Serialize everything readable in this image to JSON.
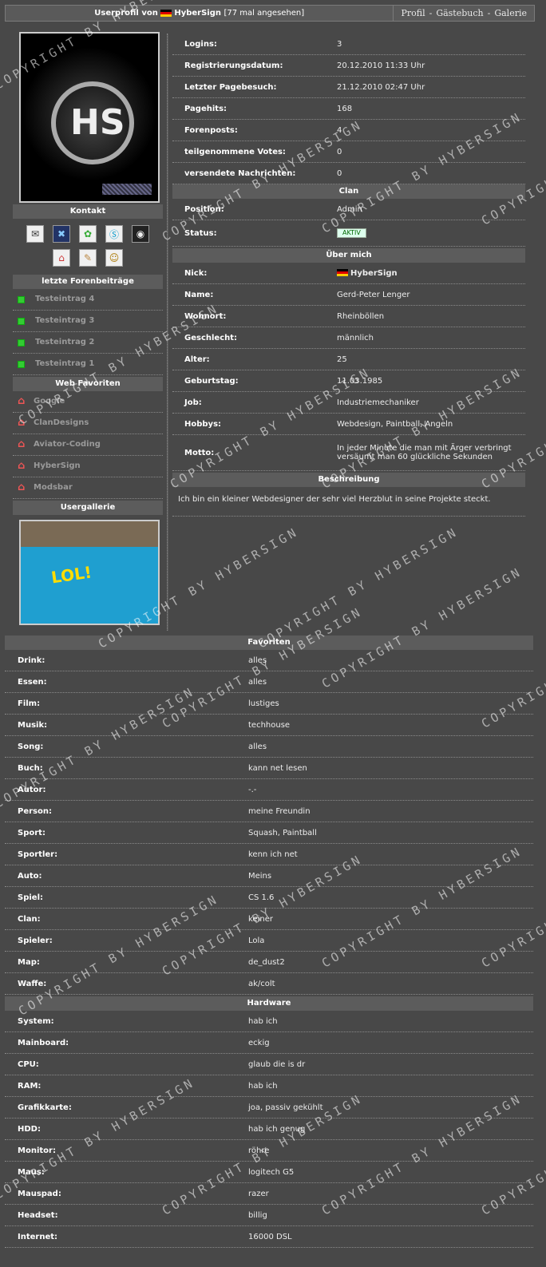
{
  "topbar": {
    "title_prefix": "Userprofil von",
    "username": "HyberSign",
    "views": "[77 mal angesehen]",
    "nav": [
      "Profil",
      "-",
      "Gästebuch",
      "-",
      "Galerie"
    ]
  },
  "sidebar": {
    "contact_header": "Kontakt",
    "forum_header": "letzte Forenbeiträge",
    "forum_posts": [
      "Testeintrag 4",
      "Testeintrag 3",
      "Testeintrag 2",
      "Testeintrag 1"
    ],
    "favorites_header": "Web Favoriten",
    "web_favorites": [
      "Google",
      "ClanDesigns",
      "Aviator-Coding",
      "HyberSign",
      "Modsbar"
    ],
    "gallery_header": "Usergallerie",
    "gallery_caption": "LOL!"
  },
  "stats": [
    {
      "label": "Logins:",
      "value": "3"
    },
    {
      "label": "Registrierungsdatum:",
      "value": "20.12.2010 11:33 Uhr"
    },
    {
      "label": "Letzter Pagebesuch:",
      "value": "21.12.2010 02:47 Uhr"
    },
    {
      "label": "Pagehits:",
      "value": "168"
    },
    {
      "label": "Forenposts:",
      "value": "4"
    },
    {
      "label": "teilgenommene Votes:",
      "value": "0"
    },
    {
      "label": "versendete Nachrichten:",
      "value": "0"
    }
  ],
  "clan": {
    "header": "Clan",
    "position_label": "Position:",
    "position_value": "Admin",
    "status_label": "Status:",
    "status_badge": "AKTIV"
  },
  "about": {
    "header": "Über mich",
    "rows": [
      {
        "label": "Nick:",
        "value": "HyberSign"
      },
      {
        "label": "Name:",
        "value": "Gerd-Peter Lenger"
      },
      {
        "label": "Wohnort:",
        "value": "Rheinböllen"
      },
      {
        "label": "Geschlecht:",
        "value": "männlich"
      },
      {
        "label": "Alter:",
        "value": "25"
      },
      {
        "label": "Geburtstag:",
        "value": "11.03.1985"
      },
      {
        "label": "Job:",
        "value": "Industriemechaniker"
      },
      {
        "label": "Hobbys:",
        "value": "Webdesign, Paintball, Angeln"
      },
      {
        "label": "Motto:",
        "value": "In jeder Minute die man mit Ärger verbringt versäumt man 60 glückliche Sekunden"
      }
    ]
  },
  "description": {
    "header": "Beschreibung",
    "text": "Ich bin ein kleiner Webdesigner der sehr viel Herzblut in seine Projekte steckt."
  },
  "favorites": {
    "header": "Favoriten",
    "rows": [
      {
        "label": "Drink:",
        "value": "alles"
      },
      {
        "label": "Essen:",
        "value": "alles"
      },
      {
        "label": "Film:",
        "value": "lustiges"
      },
      {
        "label": "Musik:",
        "value": "techhouse"
      },
      {
        "label": "Song:",
        "value": "alles"
      },
      {
        "label": "Buch:",
        "value": "kann net lesen"
      },
      {
        "label": "Autor:",
        "value": "-.-"
      },
      {
        "label": "Person:",
        "value": "meine Freundin"
      },
      {
        "label": "Sport:",
        "value": "Squash, Paintball"
      },
      {
        "label": "Sportler:",
        "value": "kenn ich net"
      },
      {
        "label": "Auto:",
        "value": "Meins"
      },
      {
        "label": "Spiel:",
        "value": "CS 1.6"
      },
      {
        "label": "Clan:",
        "value": "keiner"
      },
      {
        "label": "Spieler:",
        "value": "Lola"
      },
      {
        "label": "Map:",
        "value": "de_dust2"
      },
      {
        "label": "Waffe:",
        "value": "ak/colt"
      }
    ]
  },
  "hardware": {
    "header": "Hardware",
    "rows": [
      {
        "label": "System:",
        "value": "hab ich"
      },
      {
        "label": "Mainboard:",
        "value": "eckig"
      },
      {
        "label": "CPU:",
        "value": "glaub die is dr"
      },
      {
        "label": "RAM:",
        "value": "hab ich"
      },
      {
        "label": "Grafikkarte:",
        "value": "joa, passiv gekühlt"
      },
      {
        "label": "HDD:",
        "value": "hab ich genug"
      },
      {
        "label": "Monitor:",
        "value": "röhre"
      },
      {
        "label": "Maus:",
        "value": "logitech G5"
      },
      {
        "label": "Mauspad:",
        "value": "razer"
      },
      {
        "label": "Headset:",
        "value": "billig"
      },
      {
        "label": "Internet:",
        "value": "16000 DSL"
      }
    ]
  },
  "watermark": "COPYRIGHT BY HYBERSIGN"
}
